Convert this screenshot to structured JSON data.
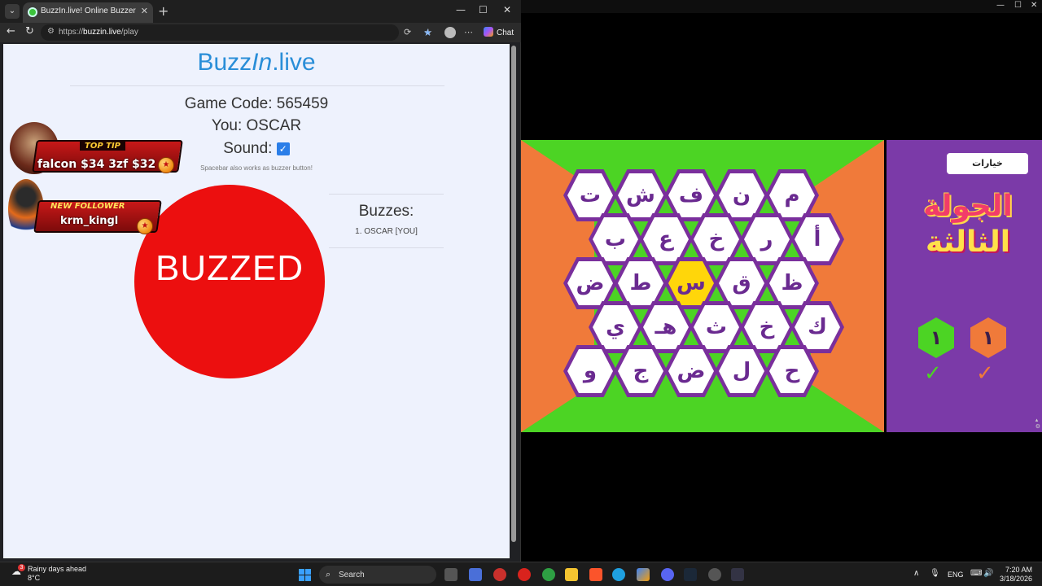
{
  "browser": {
    "tab_title": "BuzzIn.live! Online Buzzer System",
    "tab_close": "✕",
    "new_tab": "+",
    "url_scheme": "https://",
    "url_host": "buzzin.live",
    "url_path": "/play",
    "chat_label": "Chat",
    "window_controls": [
      "—",
      "☐",
      "✕"
    ]
  },
  "page": {
    "logo_part1": "Buzz",
    "logo_part2": "In",
    "logo_part3": ".live",
    "game_code": "Game Code: 565459",
    "you": "You: OSCAR",
    "sound_label": "Sound:",
    "sound_checked": "✓",
    "hint": "Spacebar also works as buzzer button!",
    "buzz_button": "BUZZED",
    "buzzes_title": "Buzzes:",
    "buzzes_list": [
      "1. OSCAR [YOU]"
    ]
  },
  "overlay": {
    "top_tip_label": "TOP TIP",
    "top_tip_line": "falcon $34    3zf $32",
    "new_follower_label": "NEW FOLLOWER",
    "new_follower_name": "krm_kingl"
  },
  "game": {
    "options_button": "خيارات",
    "round_title_line1": "الجولة",
    "round_title_line2": "الثالثة",
    "score_green": "١",
    "score_orange": "١",
    "check": "✓",
    "colors": {
      "green": "#4cd424",
      "orange": "#f07a3a",
      "purple": "#7b3aa8",
      "hex_border": "#7a2f9c",
      "active": "#ffd60a"
    },
    "rows": [
      [
        "ت",
        "ش",
        "ف",
        "ن",
        "م"
      ],
      [
        "ب",
        "ع",
        "خ",
        "ر",
        "أ"
      ],
      [
        "ض",
        "ط",
        "س",
        "ق",
        "ظ"
      ],
      [
        "ي",
        "هـ",
        "ث",
        "خ",
        "ك"
      ],
      [
        "و",
        "ج",
        "ض",
        "ل",
        "ح"
      ]
    ],
    "active_letter": "س"
  },
  "taskbar": {
    "weather_line1": "Rainy days ahead",
    "weather_line2": "8°C",
    "weather_badge": "3",
    "search_label": "Search",
    "lang": "ENG",
    "time": "7:20 AM",
    "date": "3/18/2026"
  }
}
